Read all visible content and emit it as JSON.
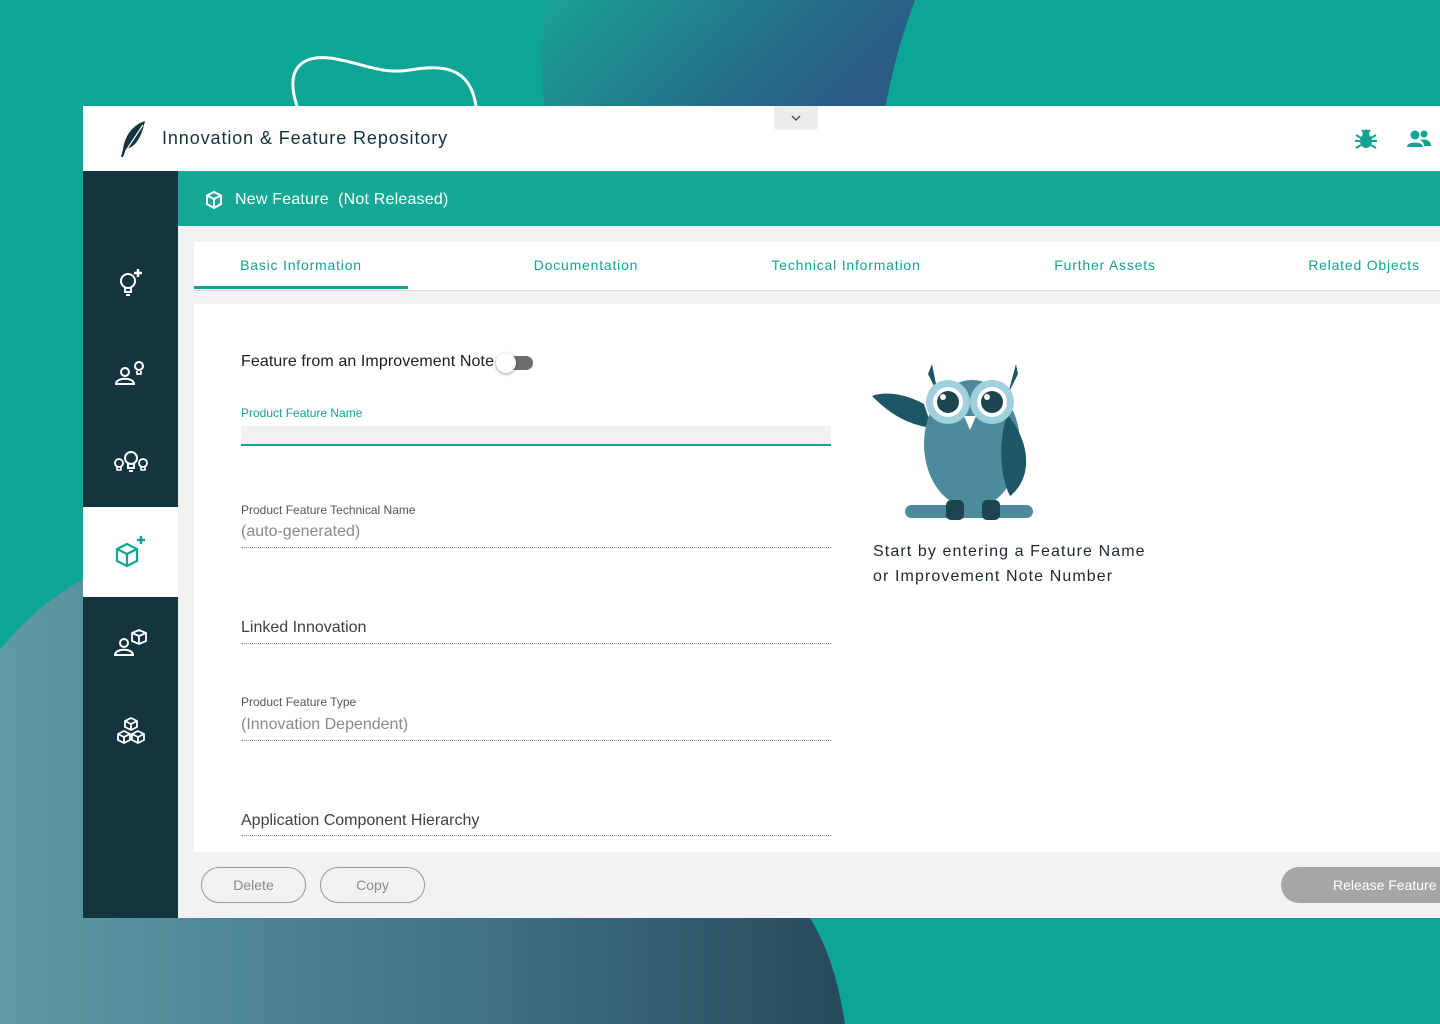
{
  "app": {
    "title": "Innovation & Feature Repository"
  },
  "header": {
    "icons": [
      "bug-icon",
      "users-icon"
    ]
  },
  "sidebar": {
    "items": [
      {
        "name": "new-innovation",
        "icon": "lightbulb-plus-icon",
        "active": false
      },
      {
        "name": "my-innovations",
        "icon": "user-lightbulb-icon",
        "active": false
      },
      {
        "name": "all-innovations",
        "icon": "lightbulbs-icon",
        "active": false
      },
      {
        "name": "new-feature",
        "icon": "cube-plus-icon",
        "active": true
      },
      {
        "name": "my-features",
        "icon": "user-cube-icon",
        "active": false
      },
      {
        "name": "all-features",
        "icon": "cubes-icon",
        "active": false
      }
    ]
  },
  "feature_bar": {
    "title": "New Feature  (Not Released)"
  },
  "tabs": [
    {
      "label": "Basic Information",
      "active": true
    },
    {
      "label": "Documentation",
      "active": false
    },
    {
      "label": "Technical Information",
      "active": false
    },
    {
      "label": "Further Assets",
      "active": false
    },
    {
      "label": "Related Objects",
      "active": false
    }
  ],
  "form": {
    "improvement_toggle": {
      "label": "Feature from an Improvement Note",
      "value": false
    },
    "feature_name": {
      "label": "Product Feature Name",
      "value": ""
    },
    "technical_name": {
      "label": "Product Feature Technical Name",
      "value": "(auto-generated)"
    },
    "linked_innovation": {
      "label": "Linked Innovation"
    },
    "feature_type": {
      "label": "Product Feature Type",
      "value": "(Innovation Dependent)"
    },
    "component_hierarchy": {
      "label": "Application Component Hierarchy"
    }
  },
  "hint": {
    "line1": "Start by entering a Feature Name",
    "line2": "or Improvement Note Number"
  },
  "actions": {
    "delete": "Delete",
    "copy": "Copy",
    "release": "Release Feature"
  },
  "colors": {
    "accent": "#12a493",
    "sidebar": "#14343f",
    "background": "#0ea596"
  }
}
